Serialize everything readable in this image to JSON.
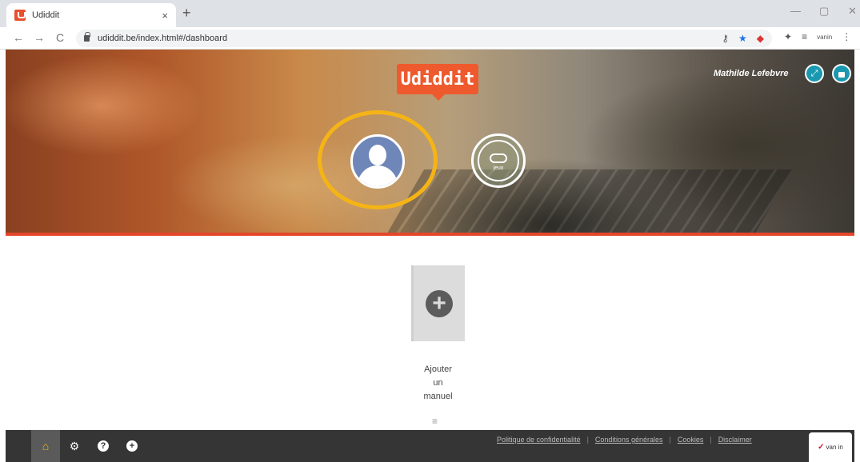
{
  "browser": {
    "tab_title": "Udiddit",
    "tab_close": "×",
    "new_tab": "+",
    "url": "udiddit.be/index.html#/dashboard",
    "window_min": "—",
    "window_max": "▢",
    "window_close": "✕",
    "nav_back": "←",
    "nav_forward": "→",
    "nav_reload": "C",
    "icons": [
      "key-icon",
      "star-icon",
      "color-extension-icon",
      "puzzle-icon",
      "playlist-icon",
      "profile-icon",
      "menu-icon"
    ]
  },
  "header": {
    "logo": "Udiddit",
    "user_name": "Mathilde Lefebvre",
    "fullscreen_icon": "⤢",
    "lock_icon": "🔒"
  },
  "tiles": {
    "jeux_label": "jeux"
  },
  "main": {
    "add_card_icon": "+",
    "add_label_lines": [
      "Ajouter",
      "un",
      "manuel"
    ],
    "menu_icon": "≡"
  },
  "bottombar": {
    "buttons": [
      {
        "icon": "home-icon",
        "glyph": "🏠"
      },
      {
        "icon": "gear-icon",
        "glyph": "⚙"
      },
      {
        "icon": "help-icon",
        "glyph": "?"
      },
      {
        "icon": "add-icon",
        "glyph": "+"
      }
    ],
    "links": [
      "Politique de confidentialité",
      "Conditions générales",
      "Cookies",
      "Disclaimer"
    ],
    "separator": "|",
    "brand": "van in",
    "brand_check": "✓"
  },
  "colors": {
    "accent": "#ee5a2d",
    "highlight": "#f5b416",
    "hero_line": "#e4462a",
    "round_button": "#1a98b0"
  }
}
